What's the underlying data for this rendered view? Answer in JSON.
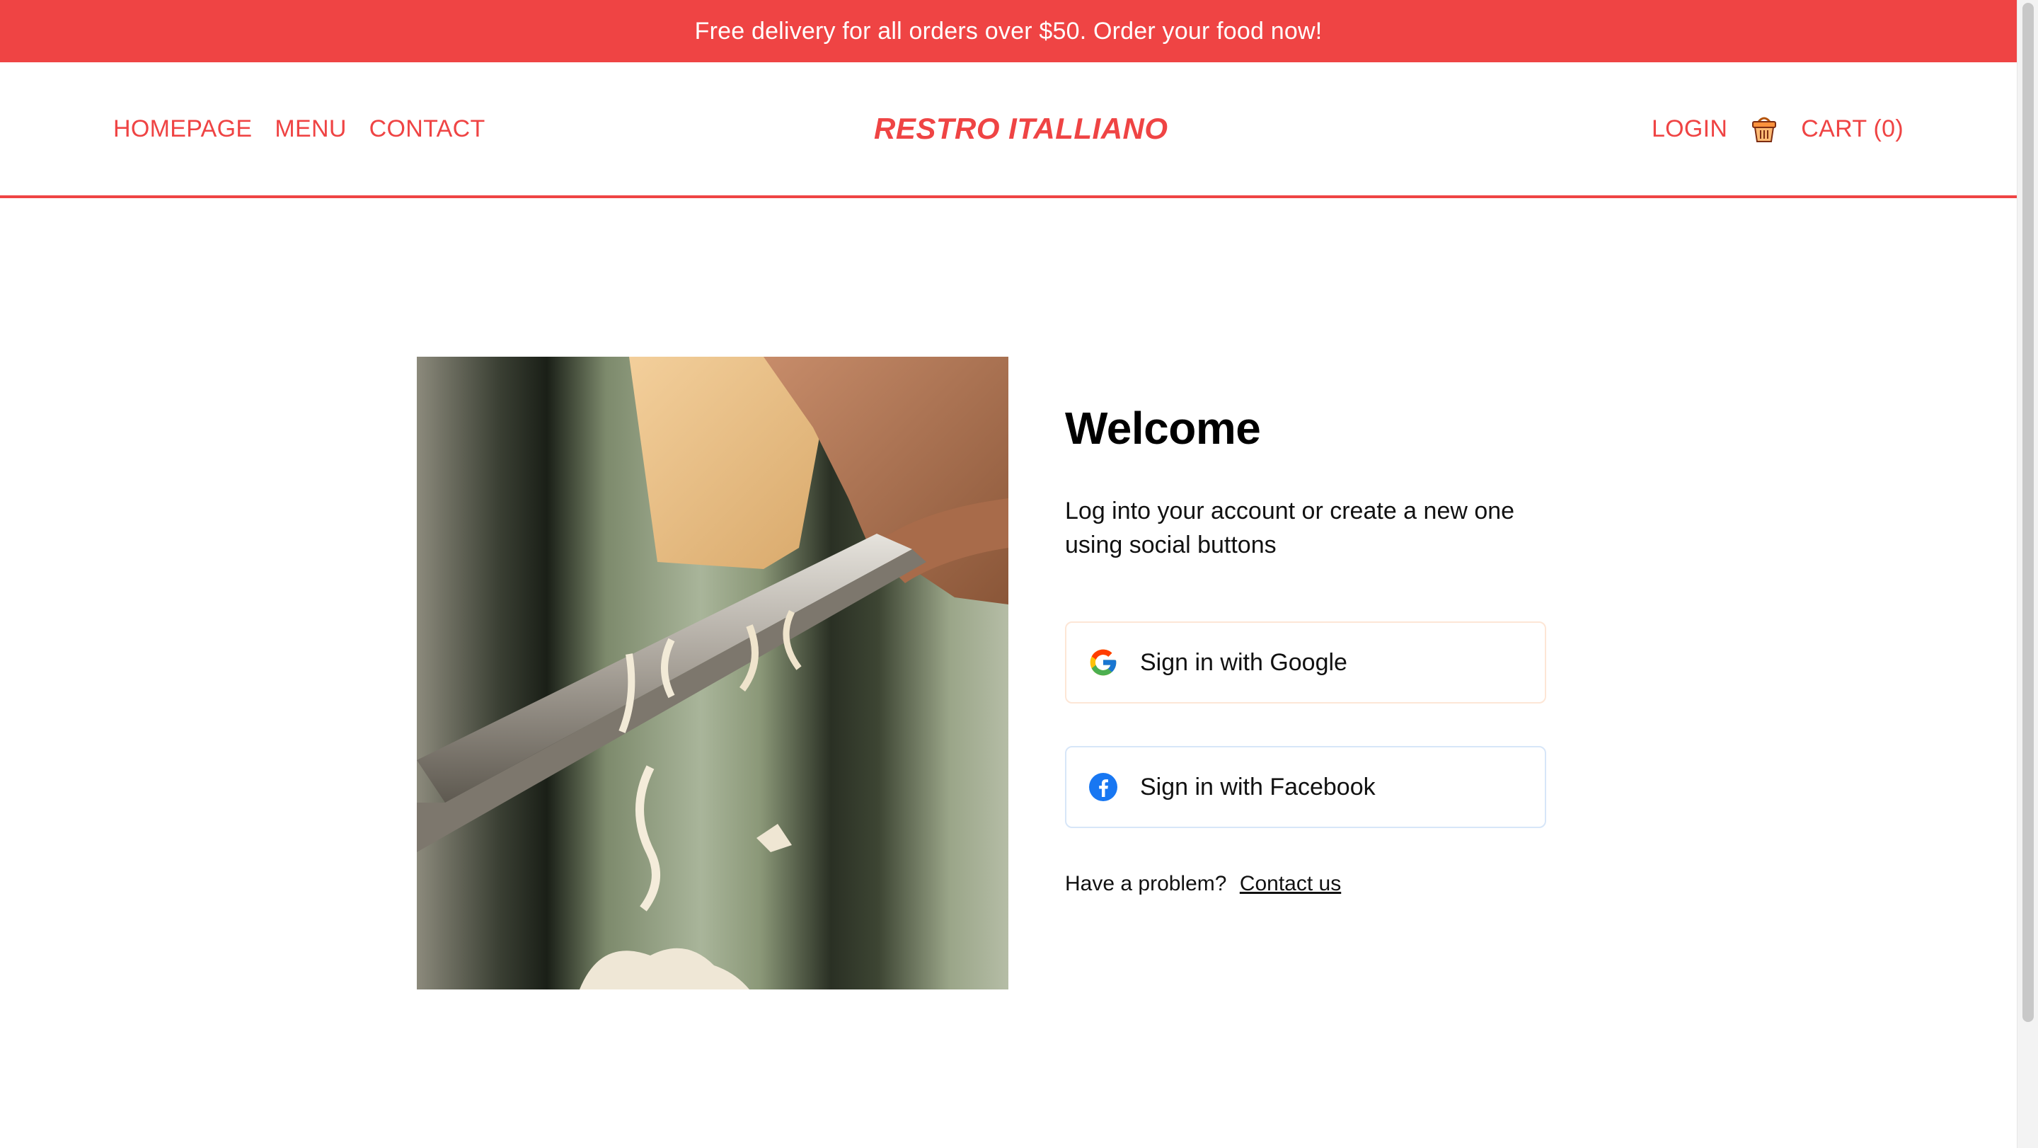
{
  "promo": {
    "text": "Free delivery for all orders over $50. Order your food now!"
  },
  "header": {
    "nav": [
      "HOMEPAGE",
      "MENU",
      "CONTACT"
    ],
    "brand": "RESTRO ITALLIANO",
    "login": "LOGIN",
    "cart": "CART (0)",
    "cart_icon": "basket-icon"
  },
  "login_panel": {
    "title": "Welcome",
    "subtitle": "Log into your account or create a new one using social buttons",
    "google_label": "Sign in with Google",
    "facebook_label": "Sign in with Facebook",
    "help_text": "Have a problem?",
    "help_link": "Contact us"
  },
  "colors": {
    "accent": "#ef4444",
    "text": "#111111",
    "google_border": "#fde6d6",
    "facebook_border": "#d7e6f8",
    "facebook_blue": "#1877f2"
  }
}
